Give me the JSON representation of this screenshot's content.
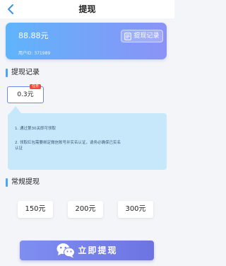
{
  "header": {
    "title": "提现",
    "back_icon": "chevron-left-icon"
  },
  "balance": {
    "amount": "88.88元",
    "user_id": "用户ID: 371989",
    "record_button_label": "提现记录",
    "record_button_icon": "document-icon"
  },
  "records_section": {
    "title": "提现记录",
    "items": [
      {
        "amount": "0.3元",
        "badge": "任务"
      }
    ]
  },
  "rules": {
    "items": [
      "1. 通过第30关即可领取",
      "2. 领取红包需要绑定微信账号并实名认证，请务必确保已实名认证"
    ]
  },
  "regular_section": {
    "title": "常规提现",
    "options": [
      "150元",
      "200元",
      "300元"
    ]
  },
  "submit": {
    "label": "立即提现",
    "icon": "wechat-icon"
  },
  "colors": {
    "accent": "#4aa5f5",
    "card_gradient_start": "#5fb4fb",
    "card_gradient_end": "#8b93f6",
    "submit_color": "#7680ec",
    "badge": "#f0483e",
    "rules_background": "#c7e7fb"
  }
}
